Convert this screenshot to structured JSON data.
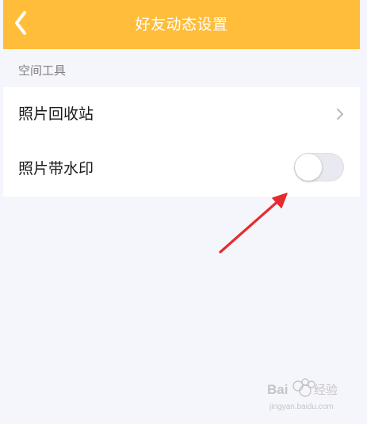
{
  "header": {
    "title": "好友动态设置",
    "back_icon": "chevron-left-icon"
  },
  "section": {
    "title": "空间工具"
  },
  "rows": [
    {
      "label": "照片回收站",
      "trailing_icon": "chevron-right-icon"
    },
    {
      "label": "照片带水印",
      "control": "toggle",
      "toggle_on": false
    }
  ],
  "watermark": {
    "brand": "Baidu 经验",
    "url": "jingyan.baidu.com"
  },
  "colors": {
    "accent": "#ffbd3a",
    "arrow": "#e52b2b",
    "background": "#f5f5fc"
  }
}
